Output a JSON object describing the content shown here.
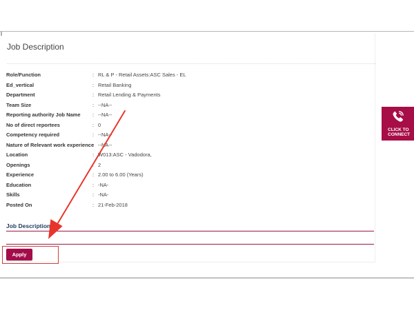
{
  "page": {
    "title": "Job Description",
    "accent_color": "#a30c4a"
  },
  "details": [
    {
      "label": "Role/Function",
      "value": "RL & P - Retail Assets:ASC Sales - EL"
    },
    {
      "label": "Ed_vertical",
      "value": "Retail Banking"
    },
    {
      "label": "Department",
      "value": "Retail Lending & Payments"
    },
    {
      "label": "Team Size",
      "value": "--NA--"
    },
    {
      "label": "Reporting authority Job Name",
      "value": "--NA--"
    },
    {
      "label": "No of direct reportees",
      "value": "0"
    },
    {
      "label": "Competency required",
      "value": "--NA--"
    },
    {
      "label": "Nature of Relevant work experience",
      "value": "--NA--"
    },
    {
      "label": "Location",
      "value": "W013:ASC - Vadodora,"
    },
    {
      "label": "Openings",
      "value": "2"
    },
    {
      "label": "Experience",
      "value": "2.00 to 6.00 (Years)"
    },
    {
      "label": "Education",
      "value": "-NA-"
    },
    {
      "label": "Skills",
      "value": "-NA-"
    },
    {
      "label": "Posted On",
      "value": "21-Feb-2018"
    }
  ],
  "separator": ":",
  "section": {
    "heading": "Job Description"
  },
  "apply_button": {
    "label": "Apply"
  },
  "connect_widget": {
    "line1": "CLICK TO",
    "line2": "CONNECT",
    "icon": "phone-icon"
  },
  "annotation": {
    "arrow_color": "#e8352b"
  }
}
